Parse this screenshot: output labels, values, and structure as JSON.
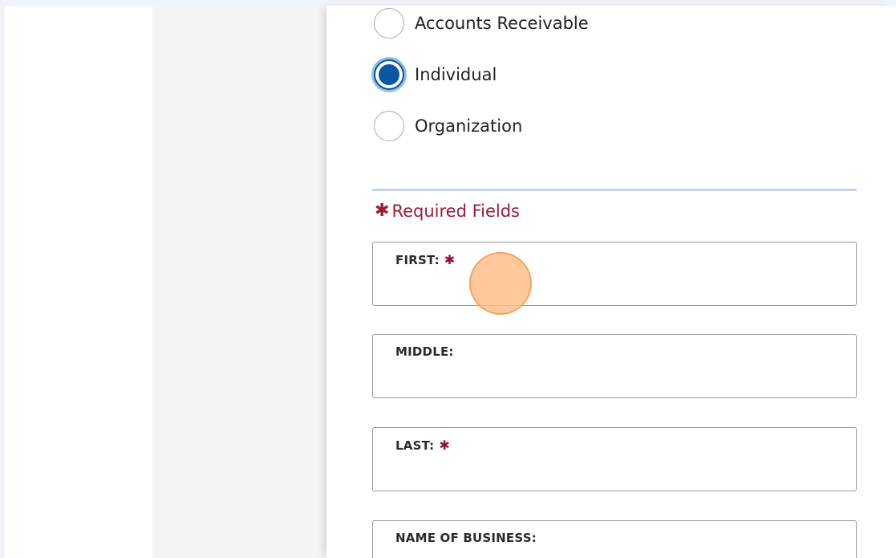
{
  "account_type": {
    "options": [
      {
        "label": "Accounts Receivable",
        "checked": false
      },
      {
        "label": "Individual",
        "checked": true
      },
      {
        "label": "Organization",
        "checked": false
      }
    ]
  },
  "form": {
    "required_note": {
      "star": "✱",
      "text": "Required Fields"
    },
    "fields": {
      "first": {
        "label": "FIRST:",
        "required_mark": "✱",
        "value": ""
      },
      "middle": {
        "label": "MIDDLE:",
        "value": ""
      },
      "last": {
        "label": "LAST:",
        "required_mark": "✱",
        "value": ""
      },
      "business": {
        "label": "NAME OF BUSINESS:",
        "value": ""
      }
    }
  },
  "colors": {
    "radio_selected": "#0b57a4",
    "required": "#9b1b3b",
    "click_marker": "#ffbe8c"
  }
}
